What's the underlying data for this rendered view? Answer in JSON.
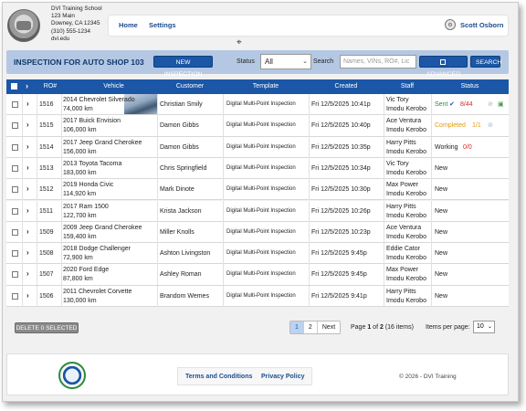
{
  "header": {
    "school_lines": [
      "DVI Training School",
      "123 Main",
      "Downey, CA 12345",
      "(310) 555-1234",
      "dvi.edu"
    ],
    "nav_home": "Home",
    "nav_settings": "Settings",
    "user_name": "Scott Osborn"
  },
  "toolbar": {
    "title": "INSPECTION FOR AUTO SHOP 103",
    "new_inspection": "NEW INSPECTION",
    "status_label": "Status",
    "status_value": "All",
    "search_label": "Search",
    "search_placeholder": "Names, VINs, RO#, Lic",
    "advanced_label": "ADVANCED",
    "search_button": "SEARCH"
  },
  "table": {
    "headers": [
      "RO#",
      "Vehicle",
      "Customer",
      "Template",
      "Created",
      "Staff",
      "Status"
    ],
    "rows": [
      {
        "ro": "1516",
        "vehicle": "2014 Chevrolet Silverado",
        "km": "74,000 km",
        "customer": "Christian Smily",
        "template": "Digital Multi-Point Inspection",
        "created": "Fri 12/5/2025 10:41p",
        "staff": "Vic Tory",
        "staff_sub": "Imodu Kerobo",
        "status": "Sent",
        "status_extra": "8/44"
      },
      {
        "ro": "1515",
        "vehicle": "2017 Buick Envision",
        "km": "106,000 km",
        "customer": "Damon Gibbs",
        "template": "Digital Multi-Point Inspection",
        "created": "Fri 12/5/2025 10:40p",
        "staff": "Ace Ventura",
        "staff_sub": "Imodu Kerobo",
        "status": "Completed",
        "status_extra": "1/1"
      },
      {
        "ro": "1514",
        "vehicle": "2017 Jeep Grand Cherokee",
        "km": "156,000 km",
        "customer": "Damon Gibbs",
        "template": "Digital Multi-Point Inspection",
        "created": "Fri 12/5/2025 10:35p",
        "staff": "Harry Pitts",
        "staff_sub": "Imodu Kerobo",
        "status": "Working",
        "status_extra": "0/0"
      },
      {
        "ro": "1513",
        "vehicle": "2013 Toyota Tacoma",
        "km": "183,000 km",
        "customer": "Chris Springfield",
        "template": "Digital Multi-Point Inspection",
        "created": "Fri 12/5/2025 10:34p",
        "staff": "Vic Tory",
        "staff_sub": "Imodu Kerobo",
        "status": "New",
        "status_extra": ""
      },
      {
        "ro": "1512",
        "vehicle": "2019 Honda Civic",
        "km": "114,920 km",
        "customer": "Mark Dinote",
        "template": "Digital Multi-Point Inspection",
        "created": "Fri 12/5/2025 10:30p",
        "staff": "Max Power",
        "staff_sub": "Imodu Kerobo",
        "status": "New",
        "status_extra": ""
      },
      {
        "ro": "1511",
        "vehicle": "2017 Ram 1500",
        "km": "122,700 km",
        "customer": "Krista Jackson",
        "template": "Digital Multi-Point Inspection",
        "created": "Fri 12/5/2025 10:26p",
        "staff": "Harry Pitts",
        "staff_sub": "Imodu Kerobo",
        "status": "New",
        "status_extra": ""
      },
      {
        "ro": "1509",
        "vehicle": "2009 Jeep Grand Cherokee",
        "km": "159,400 km",
        "customer": "Miller Knolls",
        "template": "Digital Multi-Point Inspection",
        "created": "Fri 12/5/2025 10:23p",
        "staff": "Ace Ventura",
        "staff_sub": "Imodu Kerobo",
        "status": "New",
        "status_extra": ""
      },
      {
        "ro": "1508",
        "vehicle": "2018 Dodge Challenger",
        "km": "72,900 km",
        "customer": "Ashton Livingston",
        "template": "Digital Multi-Point Inspection",
        "created": "Fri 12/5/2025 9:45p",
        "staff": "Eddie Cator",
        "staff_sub": "Imodu Kerobo",
        "status": "New",
        "status_extra": ""
      },
      {
        "ro": "1507",
        "vehicle": "2020 Ford Edge",
        "km": "87,800 km",
        "customer": "Ashley Roman",
        "template": "Digital Multi-Point Inspection",
        "created": "Fri 12/5/2025 9:45p",
        "staff": "Max Power",
        "staff_sub": "Imodu Kerobo",
        "status": "New",
        "status_extra": ""
      },
      {
        "ro": "1506",
        "vehicle": "2011 Chevrolet Corvette",
        "km": "130,000 km",
        "customer": "Brandom Wemes",
        "template": "Digital Multi-Point Inspection",
        "created": "Fri 12/5/2025 9:41p",
        "staff": "Harry Pitts",
        "staff_sub": "Imodu Kerobo",
        "status": "New",
        "status_extra": ""
      }
    ]
  },
  "pagination": {
    "delete_label": "DELETE 0 SELECTED",
    "pages": [
      "1",
      "2",
      "Next"
    ],
    "info_prefix": "Page",
    "info_page": "1",
    "info_of": "of",
    "info_total": "2",
    "info_items": "(16 items)",
    "ipp_label": "Items per page:",
    "ipp_value": "10"
  },
  "footer": {
    "terms": "Terms and Conditions",
    "privacy": "Privacy Policy",
    "copyright": "© 2026 - DVI Training"
  },
  "colors": {
    "primary": "#1b57a6",
    "sent": "#2e8b3a",
    "completed": "#e39a0c",
    "alert": "#d12a2a"
  }
}
